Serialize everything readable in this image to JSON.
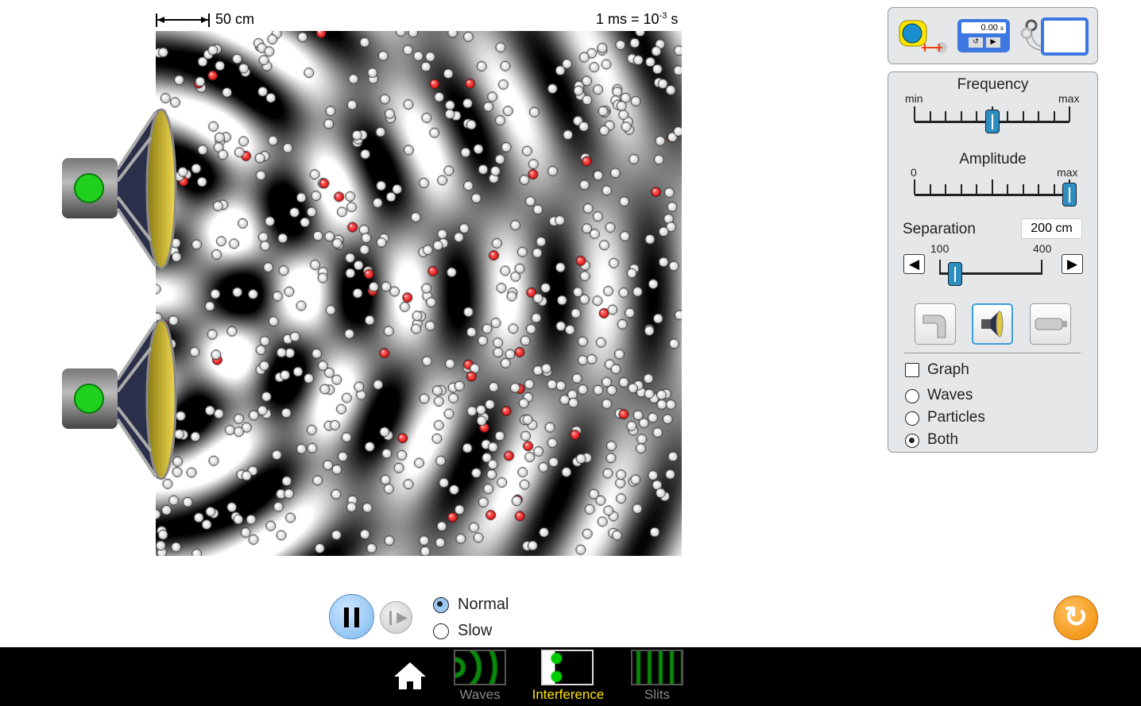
{
  "scale": {
    "label": "50 cm"
  },
  "time_unit": {
    "prefix": "1 ms = 10",
    "exp": "-3",
    "suffix": " s"
  },
  "toolbox": {
    "stopwatch": "0.00",
    "stopwatch_unit": "s",
    "icons": [
      "measuring-tape-icon",
      "stopwatch-icon",
      "wave-detector-icon"
    ]
  },
  "controls": {
    "frequency": {
      "label": "Frequency",
      "min": "min",
      "max": "max",
      "value_fraction": 0.5
    },
    "amplitude": {
      "label": "Amplitude",
      "min": "0",
      "max": "max",
      "value_fraction": 1.0
    },
    "separation": {
      "label": "Separation",
      "value": "200 cm",
      "min": "100",
      "max": "400",
      "value_fraction": 0.15
    },
    "sources": [
      "faucet-icon",
      "speaker-icon",
      "laser-icon"
    ],
    "selected_source": "speaker",
    "graph": {
      "label": "Graph",
      "checked": false
    },
    "view": [
      {
        "label": "Waves",
        "selected": false
      },
      {
        "label": "Particles",
        "selected": false
      },
      {
        "label": "Both",
        "selected": true
      }
    ]
  },
  "playback": {
    "speed": [
      {
        "label": "Normal",
        "selected": true
      },
      {
        "label": "Slow",
        "selected": false
      }
    ]
  },
  "nav": {
    "screens": [
      {
        "label": "Waves",
        "active": false
      },
      {
        "label": "Interference",
        "active": true
      },
      {
        "label": "Slits",
        "active": false
      }
    ]
  },
  "colors": {
    "accent_active": "#ffe400",
    "thumb": "#2f8ec0",
    "source_green": "#1fd01f",
    "particle_red": "#e00000"
  }
}
